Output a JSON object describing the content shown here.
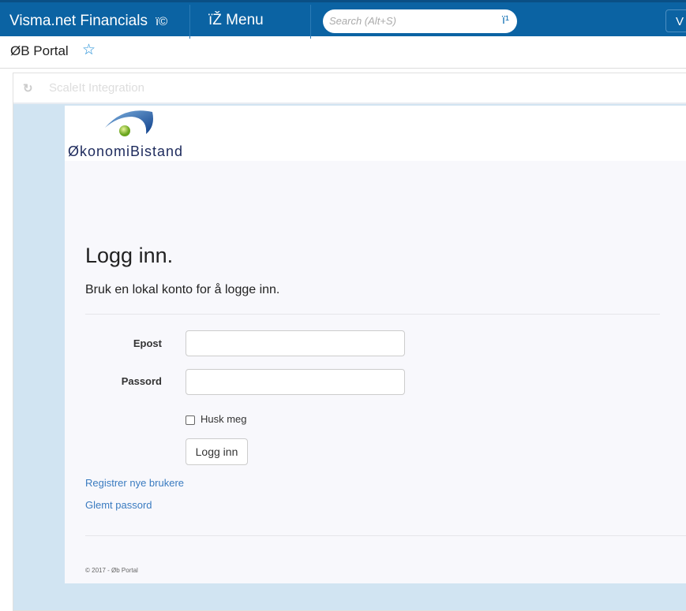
{
  "topbar": {
    "app_title": "Visma.net Financials",
    "app_icon_glyph": "ï©",
    "menu_icon_glyph": "ïŽ",
    "menu_label": "Menu",
    "search_placeholder": "Search (Alt+S)",
    "search_icon_glyph": "ï¹",
    "right_button": "V"
  },
  "subheader": {
    "title": "ØB Portal",
    "favorite_icon": "star-outline-icon"
  },
  "frame_toolbar": {
    "refresh_icon": "refresh-icon",
    "title": "ScaleIt Integration"
  },
  "logo": {
    "text": "ØkonomiBistand"
  },
  "login": {
    "heading": "Logg inn.",
    "lead": "Bruk en lokal konto for å logge inn.",
    "email_label": "Epost",
    "email_value": "",
    "password_label": "Passord",
    "password_value": "",
    "remember_label": "Husk meg",
    "remember_checked": false,
    "submit_label": "Logg inn",
    "register_link": "Registrer nye brukere",
    "forgot_link": "Glemt passord"
  },
  "footer": {
    "text": "© 2017 - Øb Portal"
  },
  "colors": {
    "topbar": "#0b63a3",
    "link": "#3a7bc0",
    "frame_bg": "#d1e4f2"
  }
}
